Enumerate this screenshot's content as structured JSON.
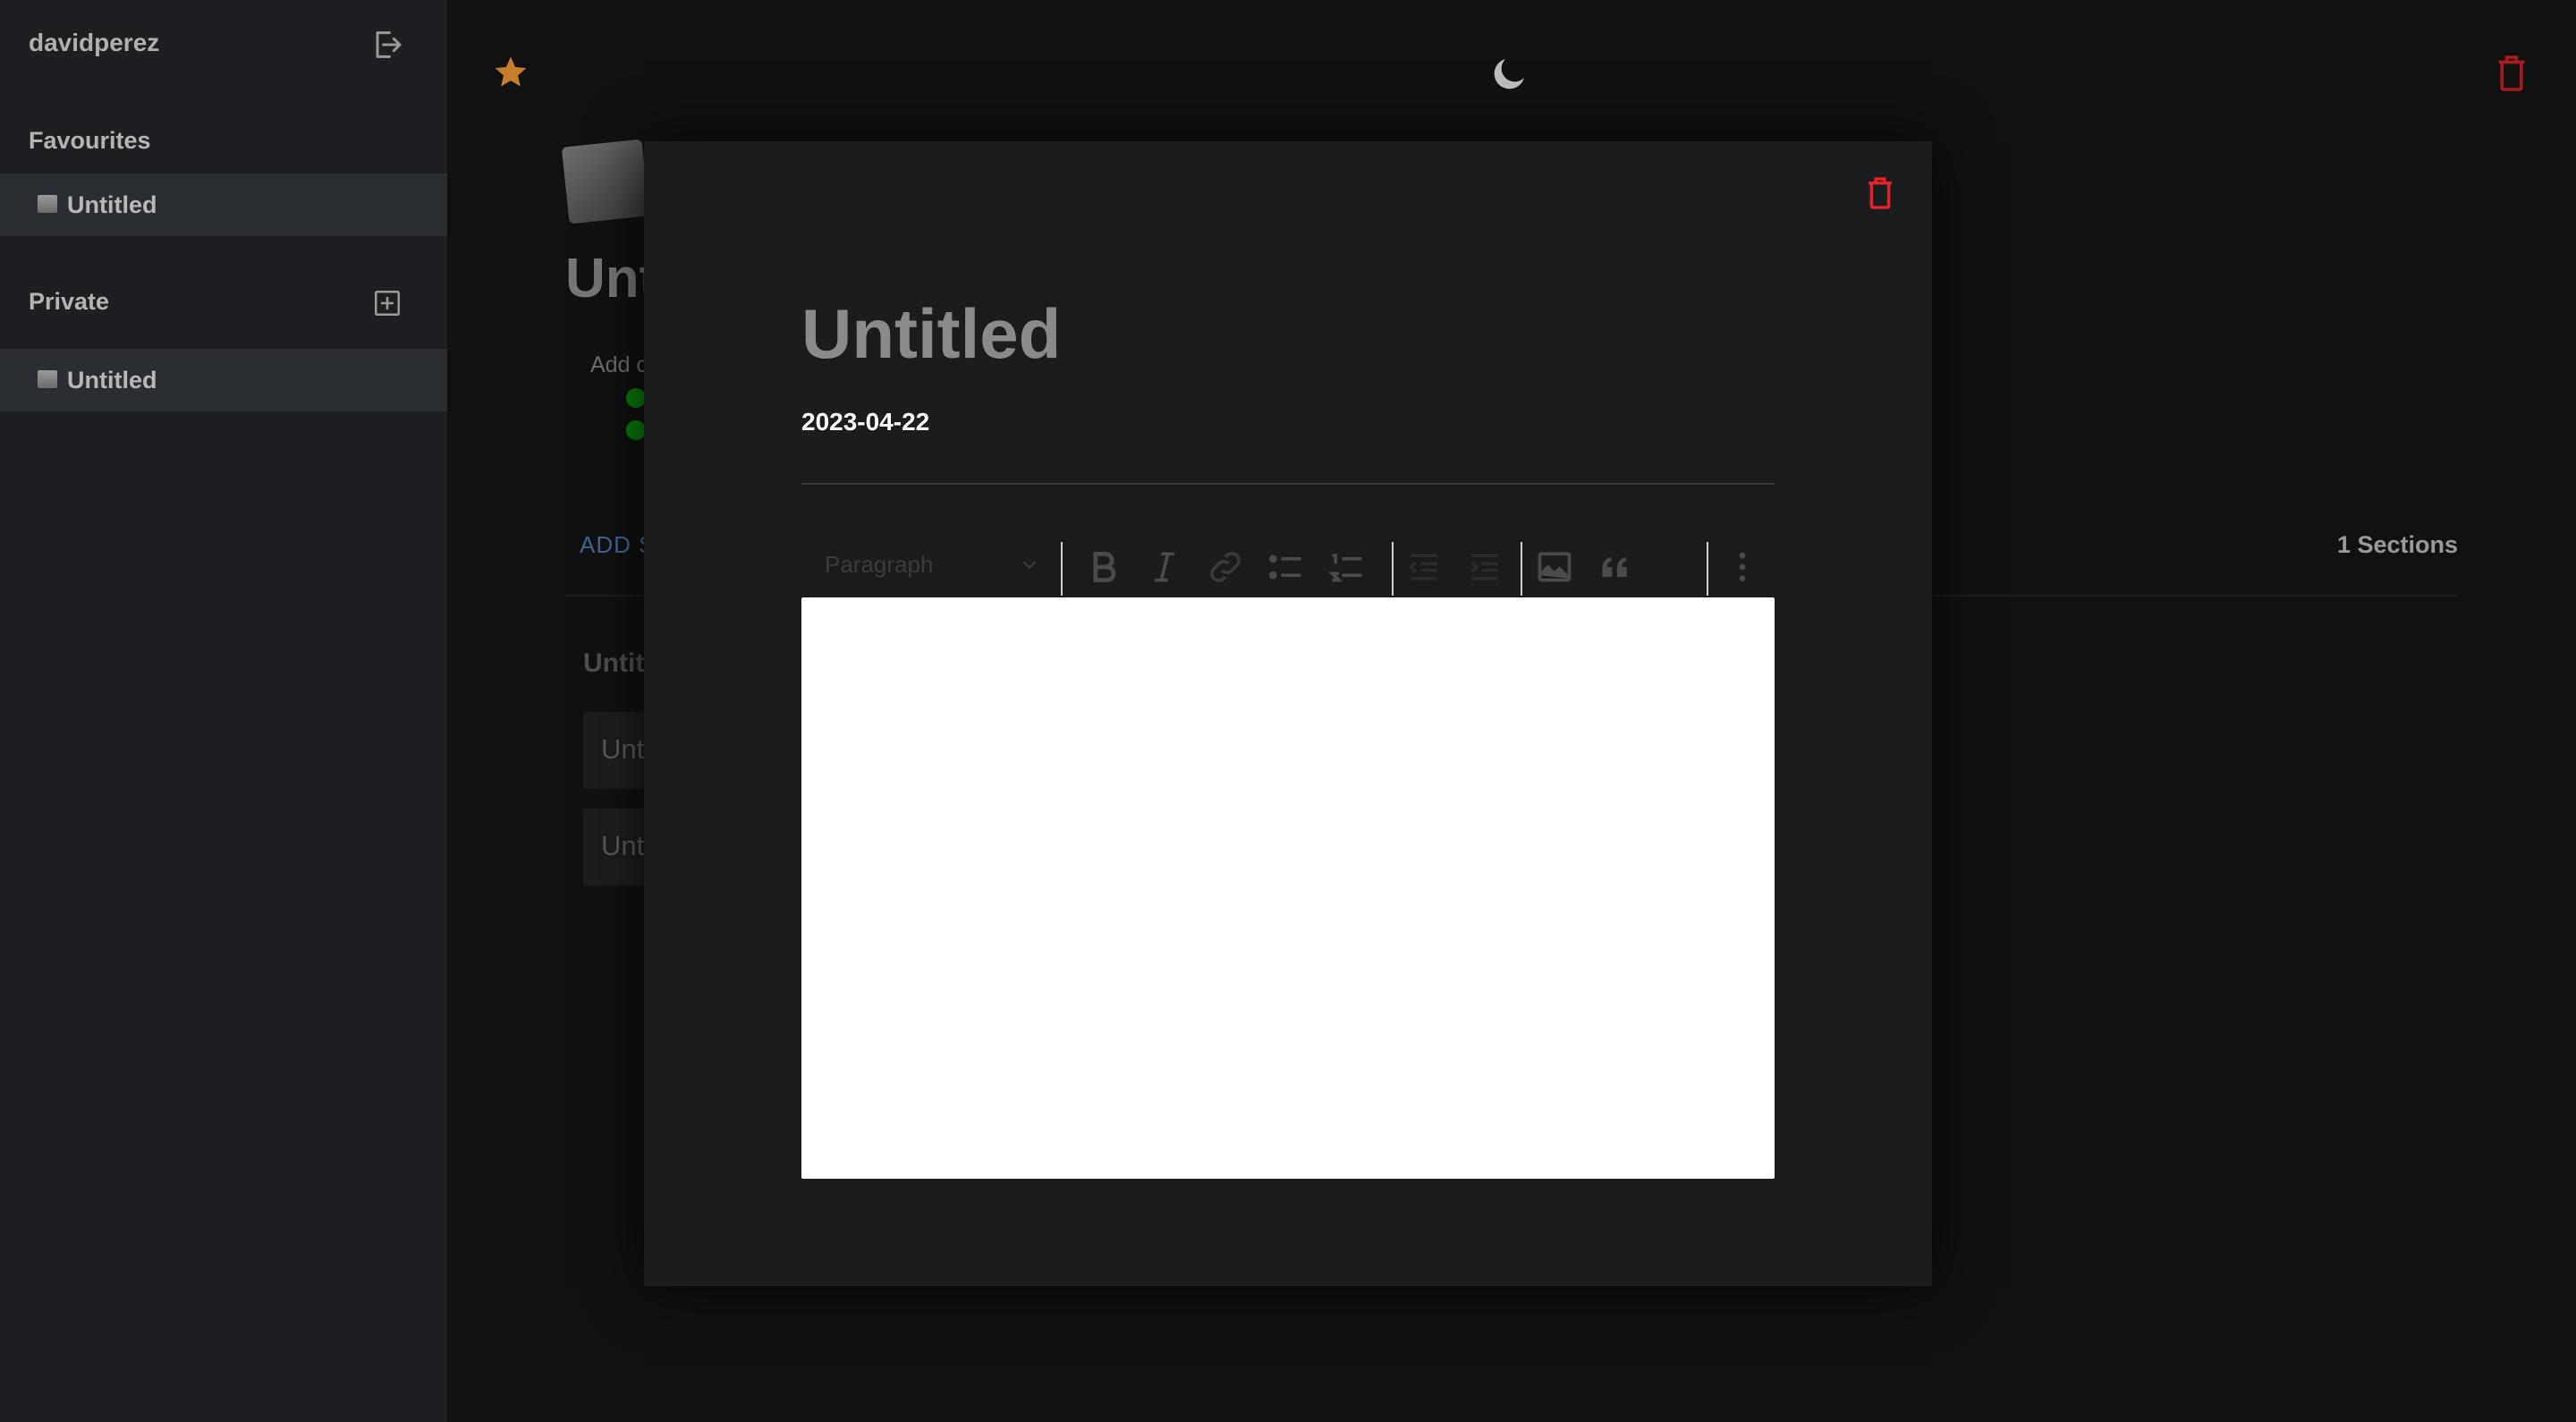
{
  "sidebar": {
    "username": "davidperez",
    "favourites_heading": "Favourites",
    "favourites": [
      {
        "label": "Untitled"
      }
    ],
    "private_heading": "Private",
    "private": [
      {
        "label": "Untitled"
      }
    ]
  },
  "main": {
    "page_title": "Untitled",
    "add_cover": "Add c",
    "add_section": "ADD S",
    "sections_count": "1 Sections",
    "section_heading": "Untit",
    "section_cards": [
      {
        "label": "Unt"
      },
      {
        "label": "Unt"
      }
    ]
  },
  "modal": {
    "title": "Untitled",
    "date": "2023-04-22",
    "block_type": "Paragraph"
  },
  "colors": {
    "accent_star": "#c77d2a",
    "danger": "#e0242a",
    "status_dot": "#0a7a0a"
  },
  "icons": [
    "logout-icon",
    "add-page-icon",
    "star-icon",
    "moon-icon",
    "trash-icon",
    "bold-icon",
    "italic-icon",
    "link-icon",
    "bullet-list-icon",
    "numbered-list-icon",
    "outdent-icon",
    "indent-icon",
    "image-icon",
    "quote-icon",
    "more-vertical-icon",
    "chevron-down-icon"
  ]
}
